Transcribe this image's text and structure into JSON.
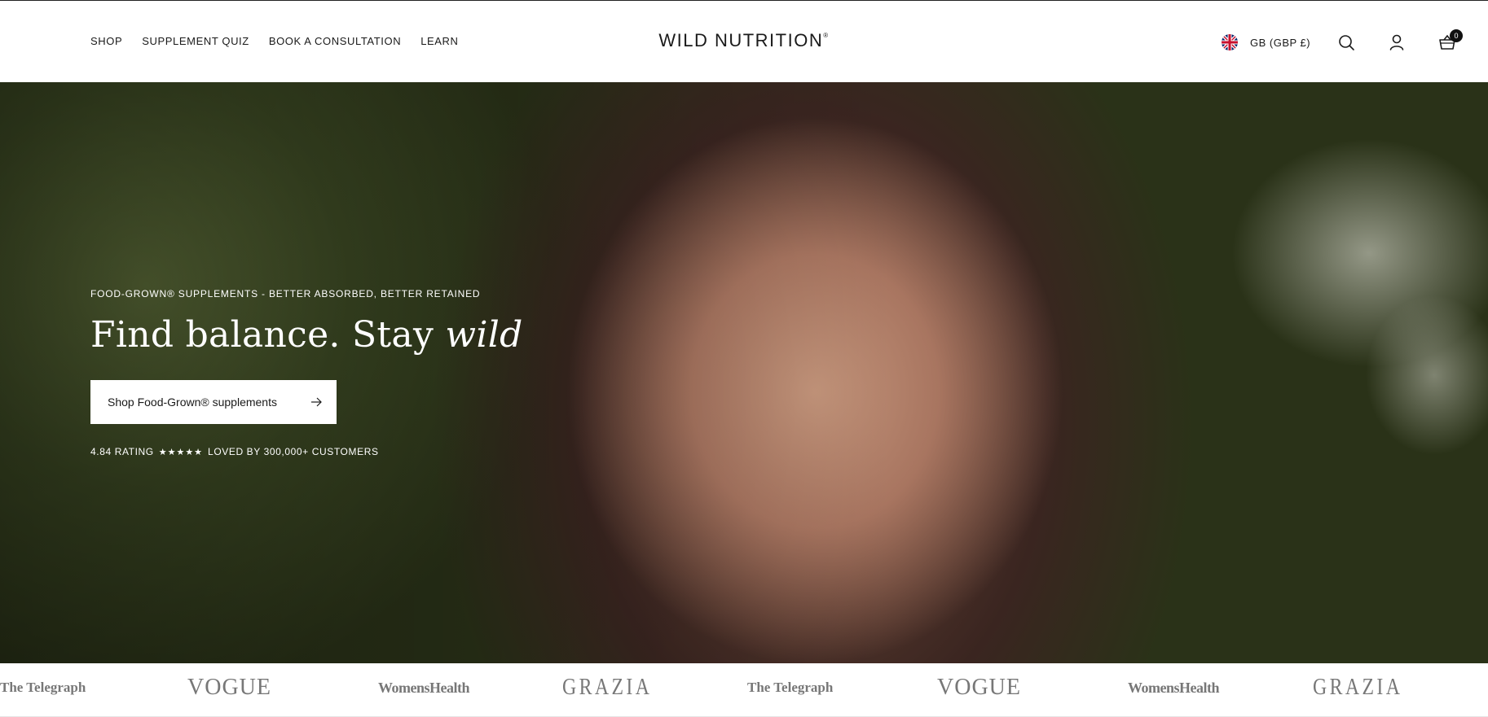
{
  "header": {
    "nav": [
      {
        "label": "SHOP"
      },
      {
        "label": "SUPPLEMENT QUIZ"
      },
      {
        "label": "BOOK A CONSULTATION"
      },
      {
        "label": "LEARN"
      }
    ],
    "logo": "WILD NUTRITION",
    "logo_mark": "®",
    "country_selector": "GB (GBP £)",
    "flag_icon": "uk-flag-icon",
    "search_icon": "search-icon",
    "account_icon": "user-icon",
    "cart_icon": "basket-icon",
    "cart_count": "0"
  },
  "hero": {
    "eyebrow": "FOOD-GROWN® SUPPLEMENTS - BETTER ABSORBED, BETTER RETAINED",
    "headline_prefix": "Find balance. Stay ",
    "headline_emphasis": "wild",
    "cta_label": "Shop Food-Grown® supplements",
    "cta_icon": "arrow-right-icon",
    "rating_value": "4.84 RATING",
    "rating_stars": "★★★★★",
    "rating_social": "LOVED BY 300,000+ CUSTOMERS"
  },
  "press": {
    "logos": [
      "The Telegraph",
      "VOGUE",
      "WomensHealth",
      "GRAZIA",
      "The Telegraph",
      "VOGUE",
      "WomensHealth",
      "GRAZIA"
    ]
  },
  "colors": {
    "header_bg": "#ffffff",
    "text": "#1a1a1a",
    "hero_text": "#ffffff",
    "press_logo": "#777777"
  }
}
